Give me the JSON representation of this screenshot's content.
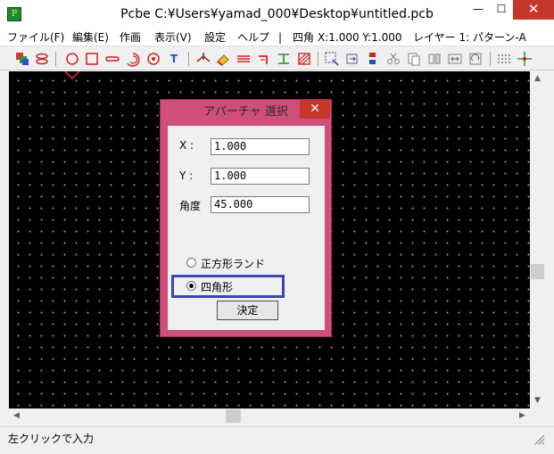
{
  "window": {
    "app_icon_glyph": "P",
    "title": "Pcbe C:¥Users¥yamad_000¥Desktop¥untitled.pcb",
    "min_glyph": "—",
    "max_glyph": "☐",
    "close_glyph": "✕"
  },
  "menu": {
    "items": [
      "ファイル(F)",
      "編集(E)",
      "作画",
      "表示(V)",
      "設定",
      "ヘルプ"
    ],
    "separator": "|",
    "status_shape": "四角",
    "coords": "X:1.000 Y:1.000",
    "layer": "レイヤー 1: パターン-A"
  },
  "toolbar": {
    "icons": [
      "layers-icon",
      "via-icon",
      "circle-icon",
      "rectangle-icon",
      "line-icon",
      "arc-icon",
      "target-icon",
      "text-icon",
      "probe-icon",
      "eraser-icon",
      "bus-icon",
      "wire-icon",
      "junction-icon",
      "hatch-icon",
      "select-icon",
      "move-icon",
      "copy-icon",
      "cut-icon",
      "paste-icon",
      "mirror-icon",
      "rotate-icon",
      "zoom-icon",
      "grid-icon",
      "crosshair-icon"
    ],
    "text_glyph": "T"
  },
  "dialog": {
    "title": "アパーチャ 選択",
    "close_glyph": "✕",
    "x_label": "X :",
    "x_value": "1.000",
    "y_label": "Y :",
    "y_value": "1.000",
    "angle_label": "角度",
    "angle_value": "45.000",
    "options": [
      {
        "label": "正方形ランド",
        "selected": false
      },
      {
        "label": "四角形",
        "selected": true
      }
    ],
    "ok_label": "決定"
  },
  "status": {
    "text": "左クリックで入力"
  },
  "colors": {
    "dialog_frame": "#d04e7a",
    "close_red": "#c7362b",
    "highlight": "#3a46b8",
    "canvas": "#000000"
  }
}
